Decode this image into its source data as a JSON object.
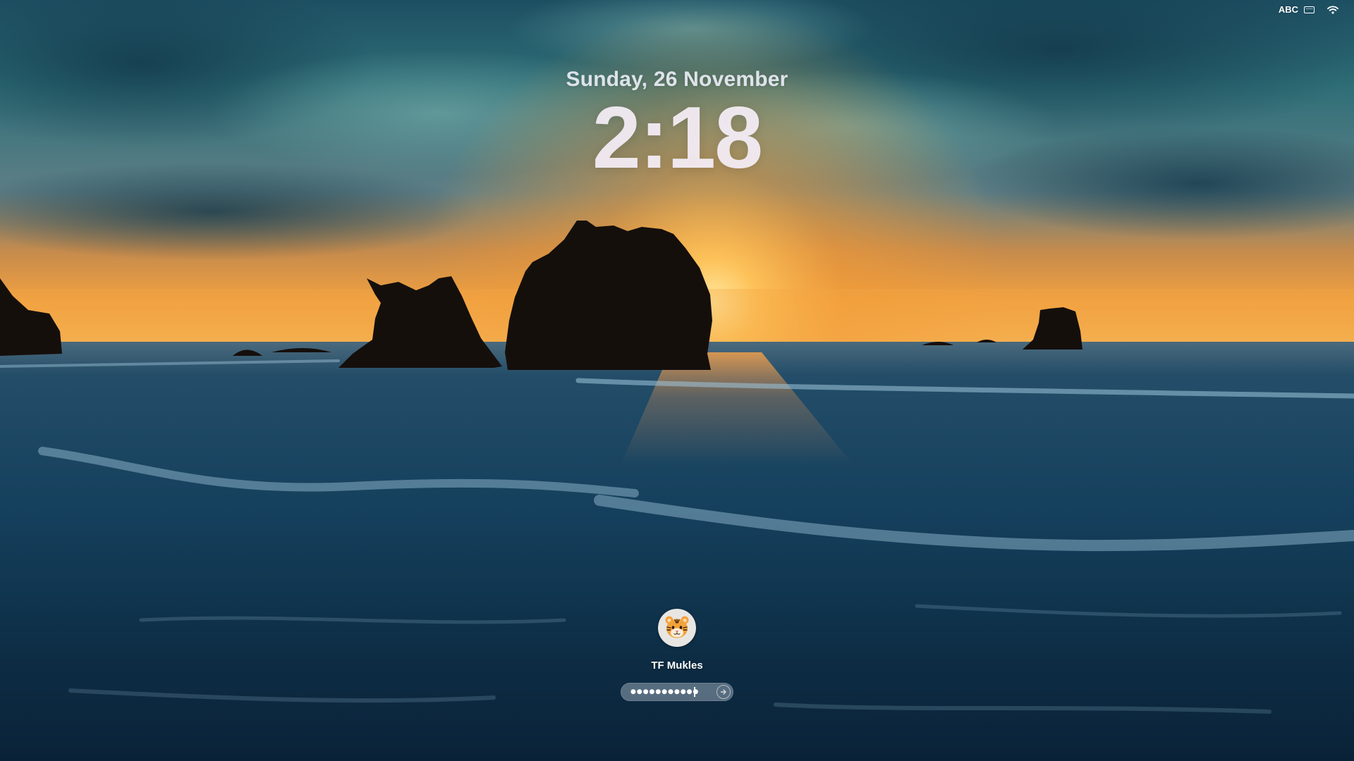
{
  "status_bar": {
    "input_source": "ABC",
    "keyboard_icon": "keyboard-icon",
    "wifi_icon": "wifi-icon"
  },
  "lock_screen": {
    "date": "Sunday, 26 November",
    "time": "2:18"
  },
  "user": {
    "name": "TF Mukles",
    "avatar_icon": "tiger-face-avatar"
  },
  "password": {
    "masked_value": "●●●●●●●●●●●",
    "submit_icon": "arrow-right-circle-icon"
  },
  "colors": {
    "sky_top": "#1b5a6e",
    "horizon_glow": "#f2a13a",
    "ocean": "#0d3550",
    "rock": "#150f0c"
  }
}
